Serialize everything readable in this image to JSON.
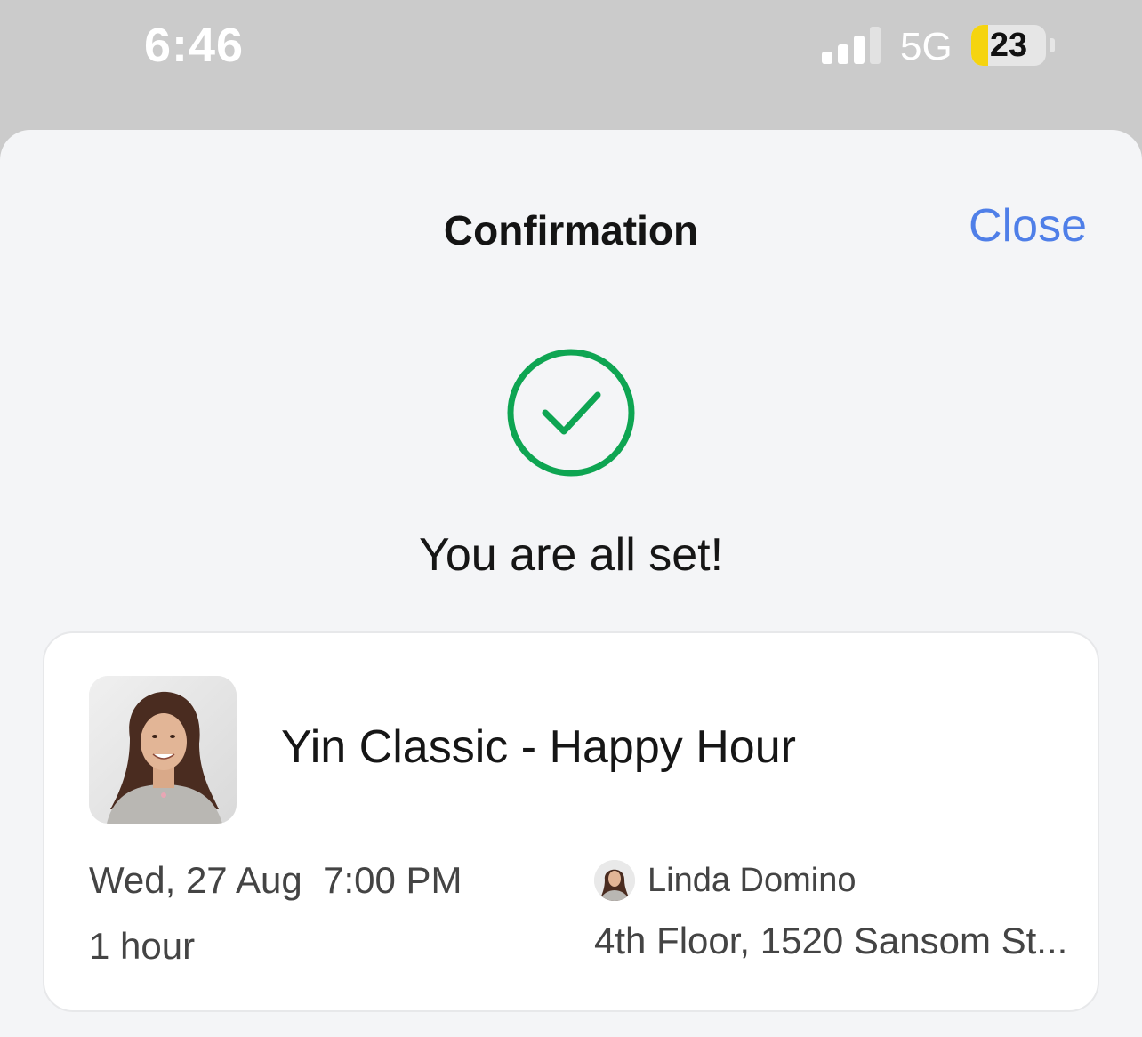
{
  "status_bar": {
    "time": "6:46",
    "network": "5G",
    "battery_level": "23",
    "battery_fraction": 0.23,
    "signal_bars_active": 3,
    "signal_bars_total": 4
  },
  "sheet": {
    "title": "Confirmation",
    "close_label": "Close",
    "success_message": "You are all set!",
    "success_icon": "checkmark-circle-icon",
    "accent_color": "#4f7fe8",
    "success_color": "#0ea552"
  },
  "booking": {
    "class_title": "Yin Classic - Happy Hour",
    "date": "Wed, 27 Aug",
    "time": "7:00 PM",
    "duration": "1 hour",
    "instructor_name": "Linda Domino",
    "location": "4th Floor, 1520 Sansom St..."
  }
}
